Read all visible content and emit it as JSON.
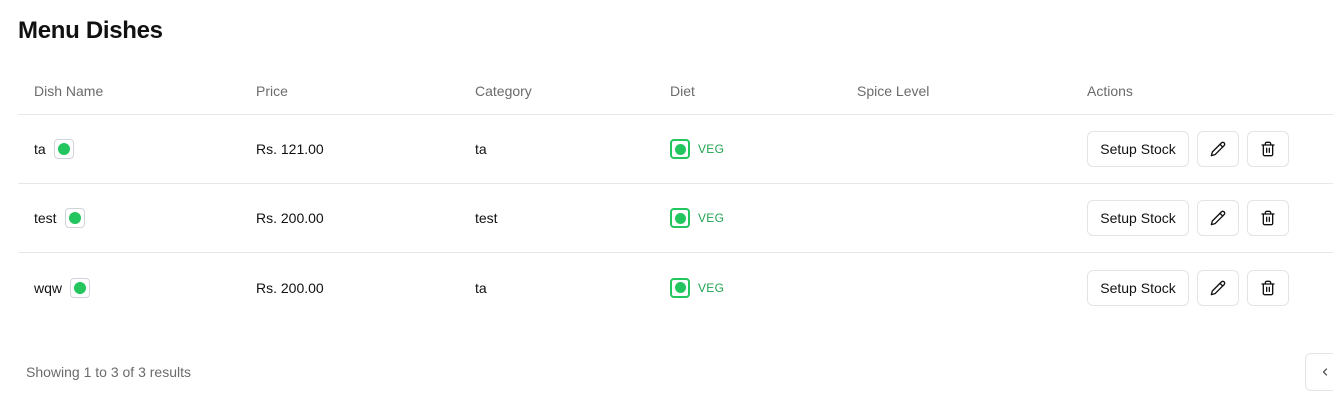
{
  "page": {
    "title": "Menu Dishes"
  },
  "table": {
    "headers": {
      "name": "Dish Name",
      "price": "Price",
      "category": "Category",
      "diet": "Diet",
      "spice": "Spice Level",
      "actions": "Actions"
    },
    "rows": [
      {
        "name": "ta",
        "price": "Rs. 121.00",
        "category": "ta",
        "diet": "VEG",
        "spice": "",
        "stock_label": "Setup Stock"
      },
      {
        "name": "test",
        "price": "Rs. 200.00",
        "category": "test",
        "diet": "VEG",
        "spice": "",
        "stock_label": "Setup Stock"
      },
      {
        "name": "wqw",
        "price": "Rs. 200.00",
        "category": "ta",
        "diet": "VEG",
        "spice": "",
        "stock_label": "Setup Stock"
      }
    ]
  },
  "footer": {
    "results_text": "Showing 1 to 3 of 3 results"
  },
  "colors": {
    "status_active": "#22c55e",
    "veg": "#22c55e",
    "veg_text": "#22a352",
    "border": "#e5e7eb"
  },
  "icons": {
    "edit": "pencil-icon",
    "delete": "trash-icon",
    "prev": "chevron-left-icon"
  }
}
